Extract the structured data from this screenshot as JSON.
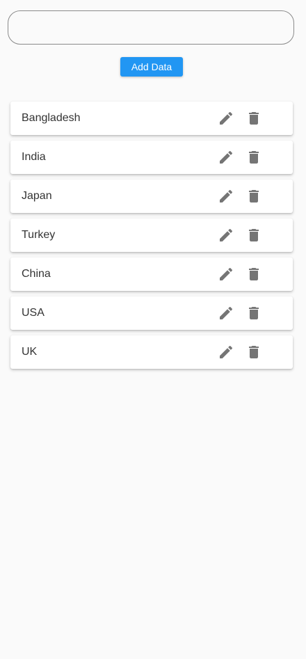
{
  "input": {
    "value": "",
    "placeholder": ""
  },
  "add_button": {
    "label": "Add Data"
  },
  "countries": [
    {
      "name": "Bangladesh"
    },
    {
      "name": "India"
    },
    {
      "name": "Japan"
    },
    {
      "name": "Turkey"
    },
    {
      "name": "China"
    },
    {
      "name": "USA"
    },
    {
      "name": "UK"
    }
  ],
  "icons": {
    "edit": "pencil-icon",
    "delete": "trash-icon"
  },
  "colors": {
    "accent": "#2196f3",
    "icon": "#757575",
    "background": "#fafafa"
  }
}
